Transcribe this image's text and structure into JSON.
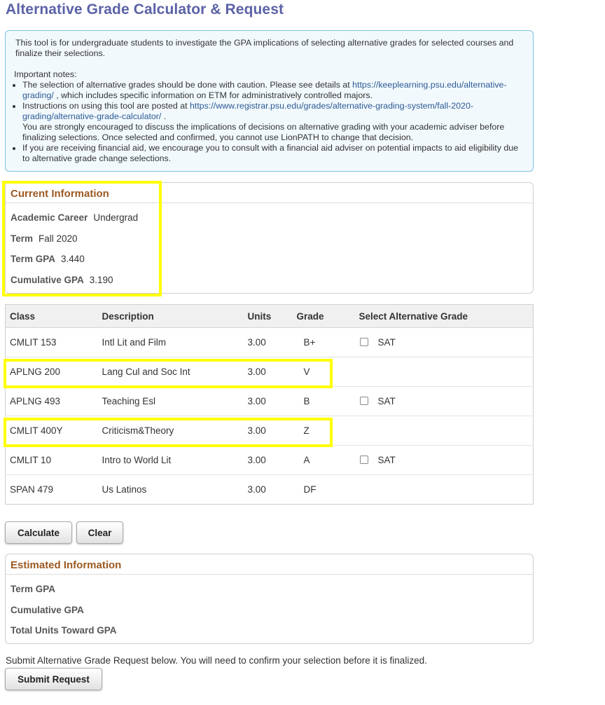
{
  "header": {
    "title": "Alternative Grade Calculator & Request"
  },
  "info": {
    "intro": "This tool is for undergraduate students to investigate the GPA implications of selecting alternative grades for selected courses and finalize their selections.",
    "notes_title": "Important notes:",
    "note1_pre": "The selection of alternative grades should be done with caution. Please see details at ",
    "note1_link": "https://keeplearning.psu.edu/alternative-grading/",
    "note1_post": " , which includes specific information on ETM for administratively controlled majors.",
    "note2_pre": "Instructions on using this tool are posted at ",
    "note2_link": "https://www.registrar.psu.edu/grades/alternative-grading-system/fall-2020-grading/alternative-grade-calculator/",
    "note2_post": " .",
    "note2_extra": "You are strongly encouraged to discuss the implications of decisions on alternative grading with your academic adviser before finalizing selections. Once selected and confirmed, you cannot use LionPATH to change that decision.",
    "note3": "If you are receiving financial aid, we encourage you to consult with a financial aid adviser on potential impacts to aid eligibility due to alternative grade change selections."
  },
  "current": {
    "title": "Current Information",
    "career_label": "Academic Career",
    "career_value": "Undergrad",
    "term_label": "Term",
    "term_value": "Fall 2020",
    "term_gpa_label": "Term GPA",
    "term_gpa_value": "3.440",
    "cum_gpa_label": "Cumulative GPA",
    "cum_gpa_value": "3.190"
  },
  "table": {
    "headers": [
      "Class",
      "Description",
      "Units",
      "Grade",
      "Select Alternative Grade"
    ],
    "rows": [
      {
        "class": "CMLIT  153",
        "description": "Intl Lit and Film",
        "units": "3.00",
        "grade": "B+",
        "alt": "SAT",
        "has_checkbox": true,
        "checked": false
      },
      {
        "class": "APLNG  200",
        "description": "Lang Cul and Soc Int",
        "units": "3.00",
        "grade": "V",
        "alt": "",
        "has_checkbox": false
      },
      {
        "class": "APLNG  493",
        "description": "Teaching Esl",
        "units": "3.00",
        "grade": "B",
        "alt": "SAT",
        "has_checkbox": true,
        "checked": false
      },
      {
        "class": "CMLIT  400Y",
        "description": "Criticism&Theory",
        "units": "3.00",
        "grade": "Z",
        "alt": "",
        "has_checkbox": false
      },
      {
        "class": "CMLIT  10",
        "description": "Intro to World Lit",
        "units": "3.00",
        "grade": "A",
        "alt": "SAT",
        "has_checkbox": true,
        "checked": false
      },
      {
        "class": "SPAN  479",
        "description": "Us Latinos",
        "units": "3.00",
        "grade": "DF",
        "alt": "",
        "has_checkbox": false
      }
    ]
  },
  "buttons": {
    "calculate": "Calculate",
    "clear": "Clear",
    "submit": "Submit Request"
  },
  "estimated": {
    "title": "Estimated Information",
    "term_gpa_label": "Term GPA",
    "cum_gpa_label": "Cumulative GPA",
    "units_label": "Total Units Toward GPA"
  },
  "submit_note": "Submit Alternative Grade Request below. You will need to confirm your selection before it is finalized.",
  "colors": {
    "title": "#5b62a6",
    "section_title": "#9b5a22",
    "info_border": "#79c3e0",
    "highlight": "#ffff00",
    "link": "#2c5a96"
  }
}
